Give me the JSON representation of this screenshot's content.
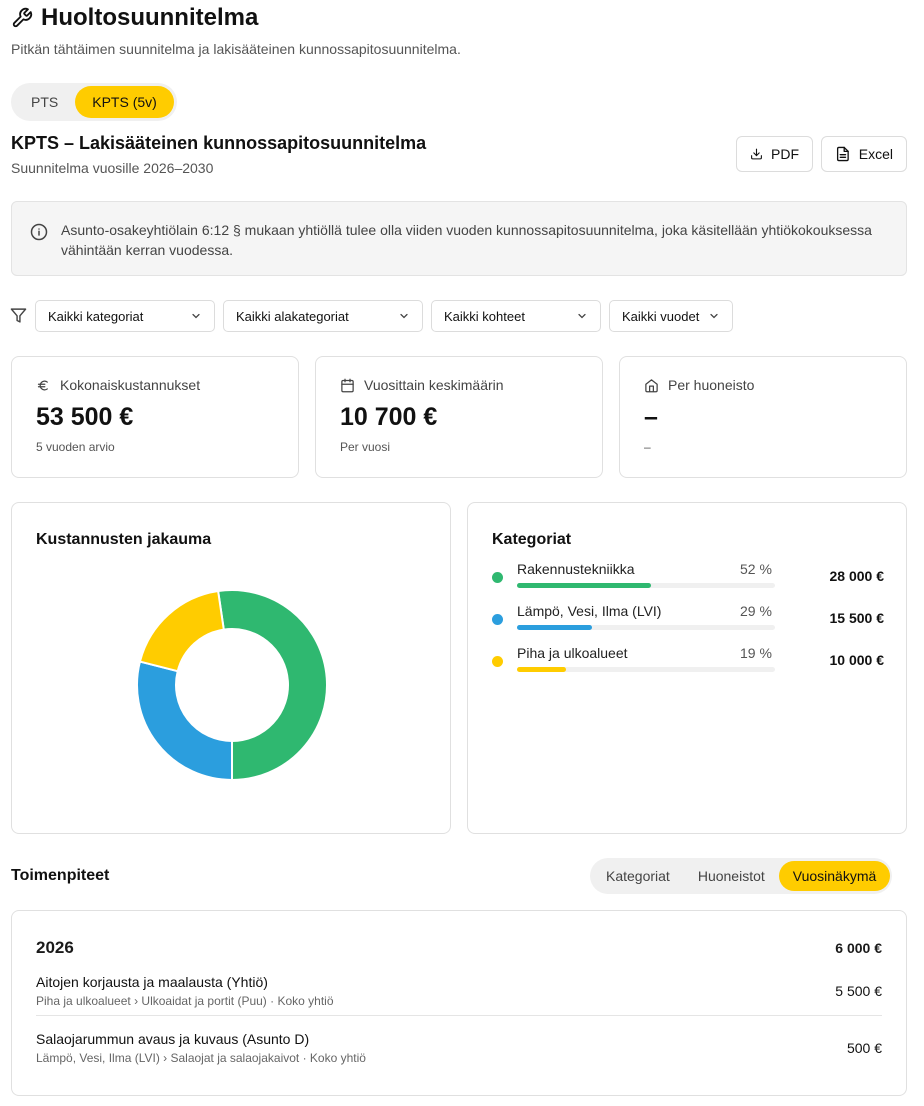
{
  "header": {
    "title": "Huoltosuunnitelma",
    "subtitle": "Pitkän tähtäimen suunnitelma ja lakisääteinen kunnossapitosuunnitelma."
  },
  "plan_tabs": [
    {
      "label": "PTS",
      "active": false
    },
    {
      "label": "KPTS (5v)",
      "active": true
    }
  ],
  "section": {
    "title": "KPTS – Lakisääteinen kunnossapitosuunnitelma",
    "subtitle": "Suunnitelma vuosille 2026–2030",
    "pdf_label": "PDF",
    "excel_label": "Excel"
  },
  "info_text": "Asunto-osakeyhtiölain 6:12 § mukaan yhtiöllä tulee olla viiden vuoden kunnossapitosuunnitelma, joka käsitellään yhtiökokouksessa vähintään kerran vuodessa.",
  "filters": {
    "categories": "Kaikki kategoriat",
    "subcategories": "Kaikki alakategoriat",
    "targets": "Kaikki kohteet",
    "years": "Kaikki vuodet"
  },
  "stats": {
    "total": {
      "label": "Kokonaiskustannukset",
      "value": "53 500 €",
      "note": "5 vuoden arvio",
      "icon": "euro-icon"
    },
    "yearly": {
      "label": "Vuosittain keskimäärin",
      "value": "10 700 €",
      "note": "Per vuosi",
      "icon": "calendar-icon"
    },
    "per_apartment": {
      "label": "Per huoneisto",
      "value": "–",
      "note": "–",
      "icon": "home-icon"
    }
  },
  "distribution": {
    "title": "Kustannusten jakauma"
  },
  "categories_card": {
    "title": "Kategoriat",
    "items": [
      {
        "name": "Rakennustekniikka",
        "pct": "52 %",
        "share": 0.52,
        "amount": "28 000 €",
        "color": "#2fb870"
      },
      {
        "name": "Lämpö, Vesi, Ilma (LVI)",
        "pct": "29 %",
        "share": 0.29,
        "amount": "15 500 €",
        "color": "#2b9ede"
      },
      {
        "name": "Piha ja ulkoalueet",
        "pct": "19 %",
        "share": 0.19,
        "amount": "10 000 €",
        "color": "#ffcc00"
      }
    ]
  },
  "chart_data": {
    "type": "pie",
    "categories": [
      "Rakennustekniikka",
      "Lämpö, Vesi, Ilma (LVI)",
      "Piha ja ulkoalueet"
    ],
    "values": [
      28000,
      15500,
      10000
    ],
    "colors": [
      "#2fb870",
      "#2b9ede",
      "#ffcc00"
    ],
    "title": "Kustannusten jakauma",
    "donut": true
  },
  "measures": {
    "title": "Toimenpiteet",
    "views": [
      {
        "label": "Kategoriat",
        "active": false
      },
      {
        "label": "Huoneistot",
        "active": false
      },
      {
        "label": "Vuosinäkymä",
        "active": true
      }
    ],
    "year": "2026",
    "year_total": "6 000 €",
    "items": [
      {
        "name": "Aitojen korjausta ja maalausta (Yhtiö)",
        "path": "Piha ja ulkoalueet › Ulkoaidat ja portit (Puu) · Koko yhtiö",
        "amount": "5 500 €"
      },
      {
        "name": "Salaojarummun avaus ja kuvaus (Asunto D)",
        "path": "Lämpö, Vesi, Ilma (LVI) › Salaojat ja salaojakaivot · Koko yhtiö",
        "amount": "500 €"
      }
    ]
  }
}
